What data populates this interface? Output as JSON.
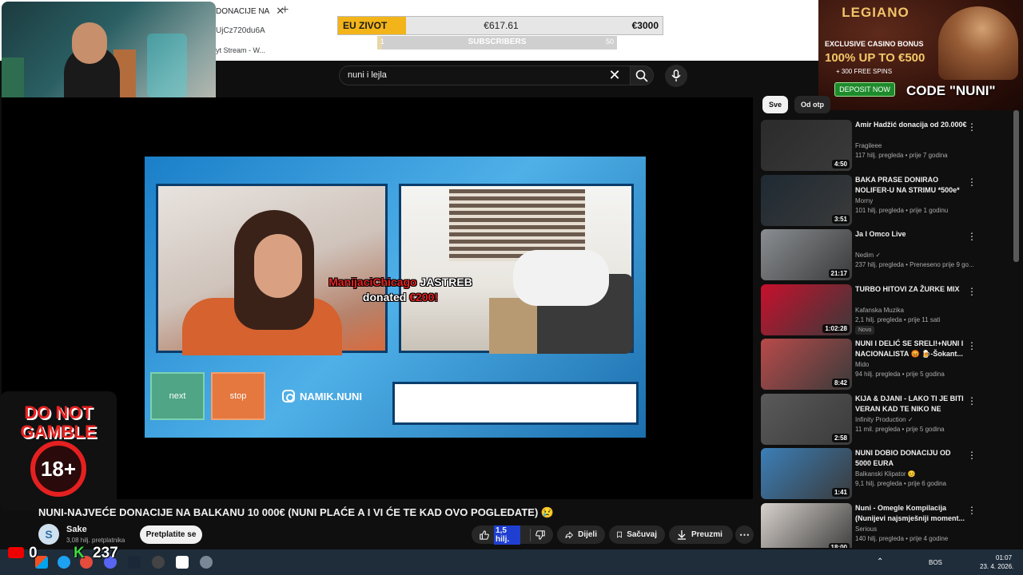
{
  "browser": {
    "tab_title": "DONACIJE NA",
    "tab_close": "✕",
    "new_tab": "+",
    "url_fragment": "UjCz720du6A",
    "bookmark_fragment": "yt Stream - W..."
  },
  "stream_overlay": {
    "goal_label": "EU ZIVOT",
    "goal_amount": "€617.61",
    "goal_target": "€3000",
    "goal_progress": 0.21,
    "subs_label": "SUBSCRIBERS",
    "subs_min": "1",
    "subs_max": "50",
    "subs_progress": 0.02,
    "counter_0": "0",
    "counter_k": "237",
    "k_letter": "K"
  },
  "ad": {
    "brand": "LEGIANO",
    "line1": "EXCLUSIVE CASINO BONUS",
    "line2": "100% UP TO €500",
    "line3": "+ 300 FREE SPINS",
    "button": "DEPOSIT NOW",
    "code": "CODE \"NUNI\""
  },
  "gamble_badge": {
    "line1": "DO NOT",
    "line2": "GAMBLE",
    "age": "18+"
  },
  "search": {
    "query": "nuni i lejla"
  },
  "video_content": {
    "donor": "ManijaciChicago",
    "donor_rest": " JASTREB",
    "donated_prefix": "donated ",
    "donated_amount": "€200!",
    "next_label": "next",
    "stop_label": "stop",
    "instagram": "NAMIK.NUNI"
  },
  "video": {
    "title": "NUNI-NAJVEĆE DONACIJE NA BALKANU 10 000€ (NUNI PLAĆE A I VI ĆE TE KAD OVO POGLEDATE) 😢",
    "channel": "Sake",
    "avatar_letter": "S",
    "subscribers": "3,08 hilj. pretplatnika",
    "subscribe": "Pretplatite se",
    "likes": "1,5 hilj.",
    "share": "Dijeli",
    "save": "Sačuvaj",
    "download": "Preuzmi",
    "more": "⋯"
  },
  "sidebar": {
    "chips": [
      "Sve",
      "Od otp"
    ],
    "recs": [
      {
        "title": "Amir Hadžić donacija od 20.000€",
        "channel": "Fragileee",
        "meta": "117 hilj. pregleda • prije 7 godina",
        "duration": "4:50",
        "color": "#2b2b2b"
      },
      {
        "title": "BAKA PRASE DONIRAO NOLIFER-U NA STRIMU *500e*",
        "channel": "Morny",
        "meta": "101 hilj. pregleda • prije 1 godinu",
        "duration": "3:51",
        "color": "#1f2a33"
      },
      {
        "title": "Ja I Omco Live",
        "channel": "Nedim ✓",
        "meta": "237 hilj. pregleda • Preneseno prije 9 go...",
        "duration": "21:17",
        "color": "#8a8e92"
      },
      {
        "title": "TURBO HITOVI ZA ŽURKE MIX",
        "channel": "Kafanska Muzika",
        "meta": "2,1 hilj. pregleda • prije 11 sati",
        "duration": "1:02:28",
        "color": "#c7102c",
        "badge": "Novo"
      },
      {
        "title": "NUNI I DELIĆ SE SRELI!+NUNI I NACIONALISTA 😡 🍺-Šokant...",
        "channel": "Mido",
        "meta": "94 hilj. pregleda • prije 5 godina",
        "duration": "8:42",
        "color": "#b94a4a"
      },
      {
        "title": "KIJA & DJANI - LAKO TI JE BITI VERAN KAD TE NIKO NE GLED...",
        "channel": "Infinity Production ✓",
        "meta": "11 mil. pregleda • prije 5 godina",
        "duration": "2:58",
        "color": "#5a5a5a"
      },
      {
        "title": "NUNI DOBIO DONACIJU OD 5000 EURA",
        "channel": "Balkanski Klipator 😊",
        "meta": "9,1 hilj. pregleda • prije 6 godina",
        "duration": "1:41",
        "color": "#3b7fb8"
      },
      {
        "title": "Nuni - Omegle Kompilacija (Nunijevi najsmješniji moment...",
        "channel": "Serious",
        "meta": "140 hilj. pregleda • prije 4 godine",
        "duration": "18:00",
        "color": "#d8d2cc"
      }
    ]
  },
  "taskbar": {
    "lang": "BOS",
    "time": "01:07",
    "date": "23. 4. 2026."
  }
}
